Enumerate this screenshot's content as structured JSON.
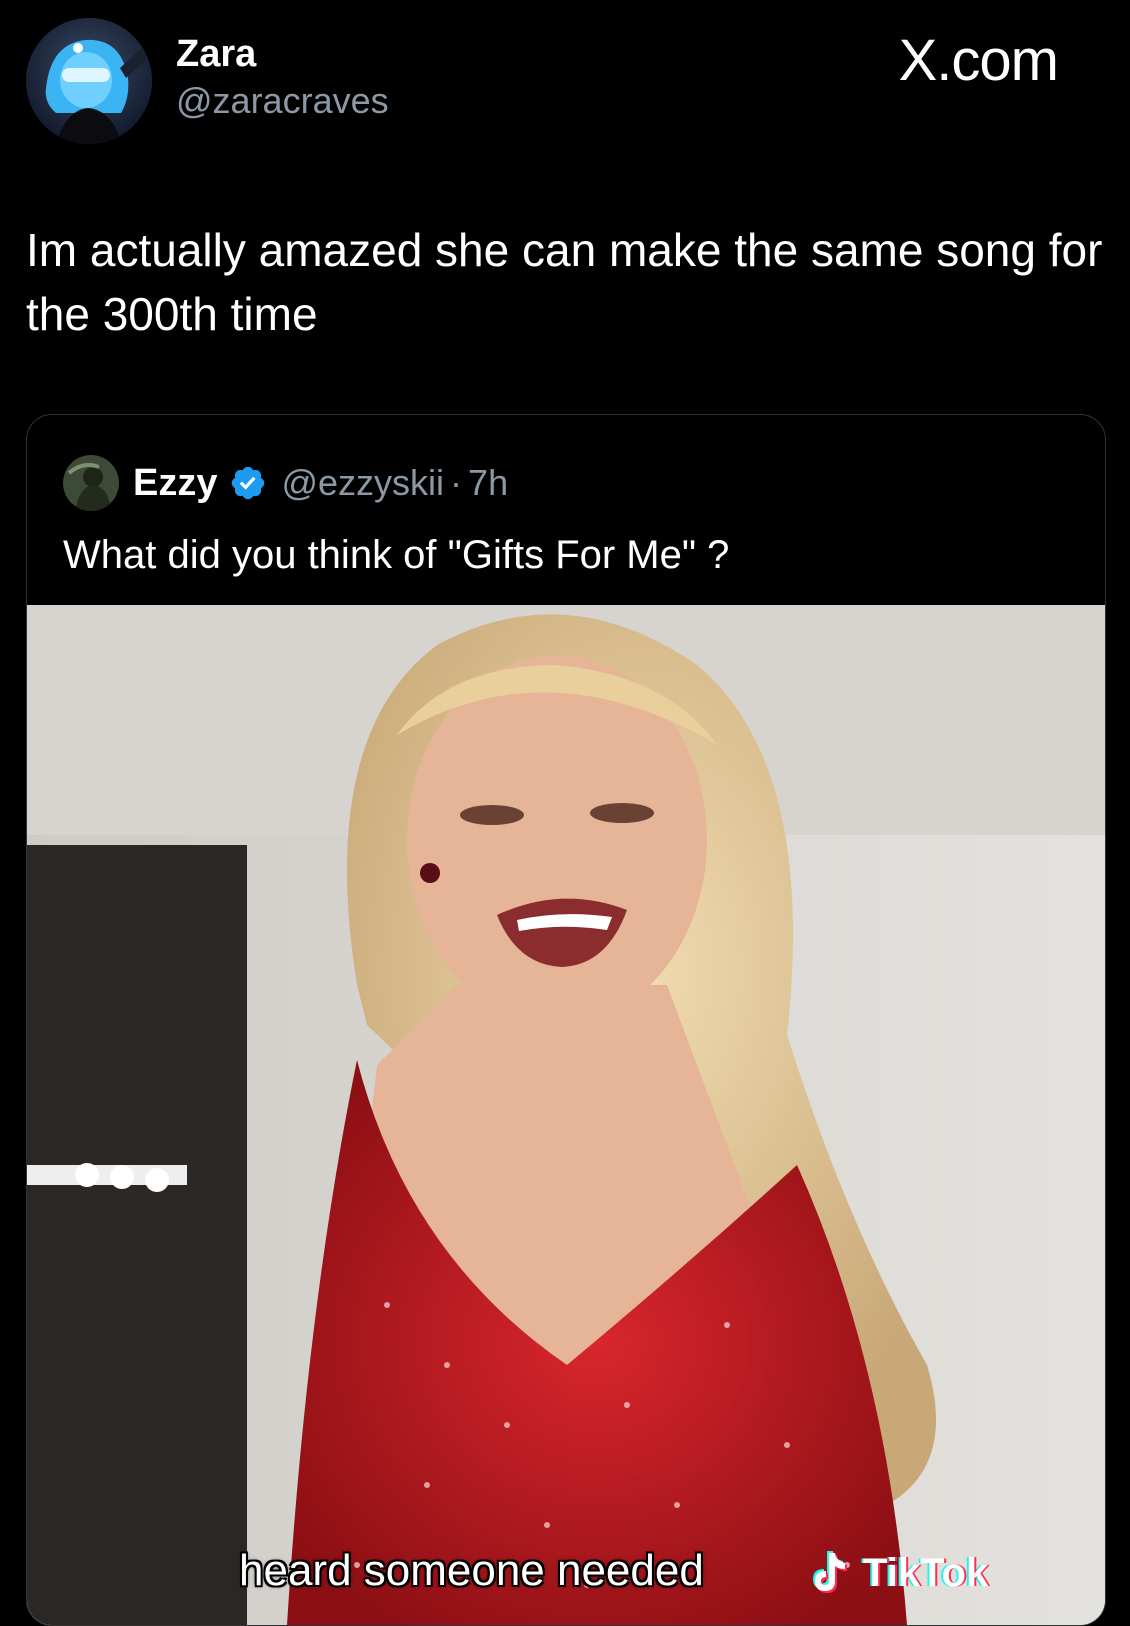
{
  "post": {
    "author": {
      "display_name": "Zara",
      "handle": "@zaracraves"
    },
    "brand_label": "X.com",
    "text": "Im actually amazed she can make the same song for the 300th time"
  },
  "quoted_post": {
    "author": {
      "display_name": "Ezzy",
      "handle": "@ezzyskii",
      "verified": true
    },
    "separator": "·",
    "time": "7h",
    "text": "What did you think of \"Gifts For Me\" ?",
    "media": {
      "caption": "heard someone needed",
      "watermark": "TikTok"
    }
  },
  "colors": {
    "background": "#000000",
    "text_primary": "#ffffff",
    "text_secondary": "#8b98a5",
    "verified_badge": "#1d9bf0",
    "card_border": "#2f3336"
  },
  "icons": {
    "verified": "verified-badge-icon",
    "tiktok": "tiktok-logo-icon"
  }
}
